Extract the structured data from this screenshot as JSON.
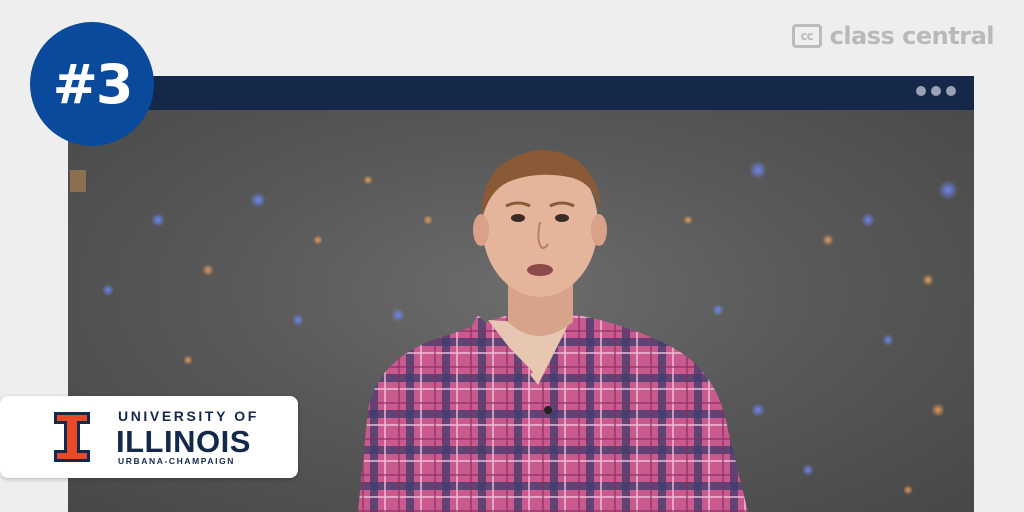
{
  "brand": {
    "icon_text": "cc",
    "name": "class central"
  },
  "rank": "#3",
  "window": {
    "menu_icon": "more-dots-icon"
  },
  "video": {
    "description_icon": "presenter-video"
  },
  "university": {
    "line1": "UNIVERSITY OF",
    "line2": "ILLINOIS",
    "line3": "URBANA-CHAMPAIGN",
    "logo_icon": "block-i-icon"
  },
  "colors": {
    "badge": "#0a4a9c",
    "titlebar": "#15284a",
    "illinois_orange": "#e84a27",
    "illinois_navy": "#13294b"
  }
}
